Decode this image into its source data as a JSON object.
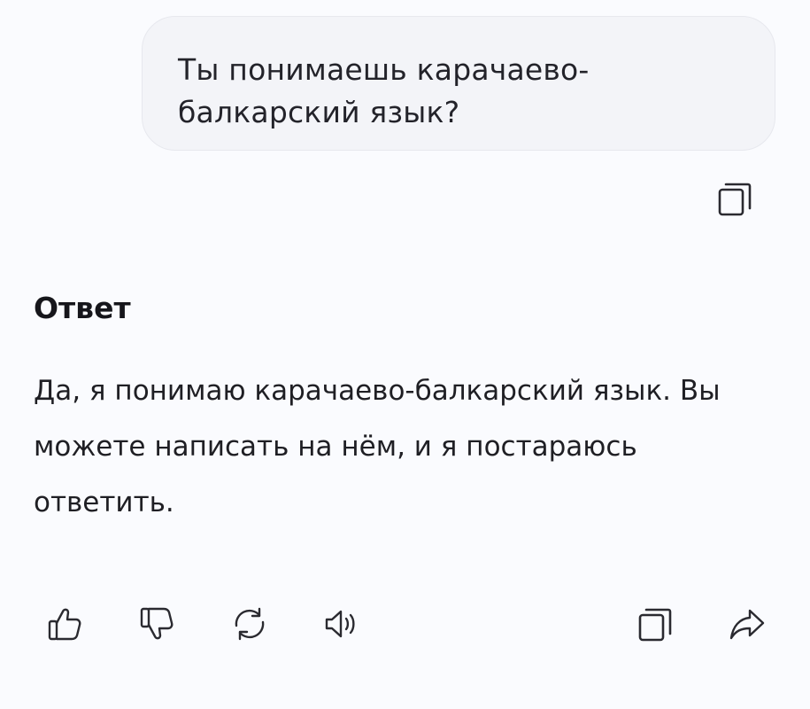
{
  "user_message": {
    "text": "Ты понимаешь карачаево-балкарский язык?"
  },
  "answer": {
    "heading": "Ответ",
    "text": "Да, я понимаю карачаево-балкарский язык. Вы можете написать на нём, и я постараюсь ответить."
  },
  "icons": {
    "copy_message": "copy-icon",
    "like": "thumbs-up-icon",
    "dislike": "thumbs-down-icon",
    "regenerate": "refresh-icon",
    "speak": "speaker-icon",
    "copy_answer": "copy-icon",
    "share": "share-icon"
  },
  "colors": {
    "background": "#fafbfe",
    "bubble": "#f3f4f8",
    "icon": "#2a2a30",
    "text": "#1f1f24"
  }
}
